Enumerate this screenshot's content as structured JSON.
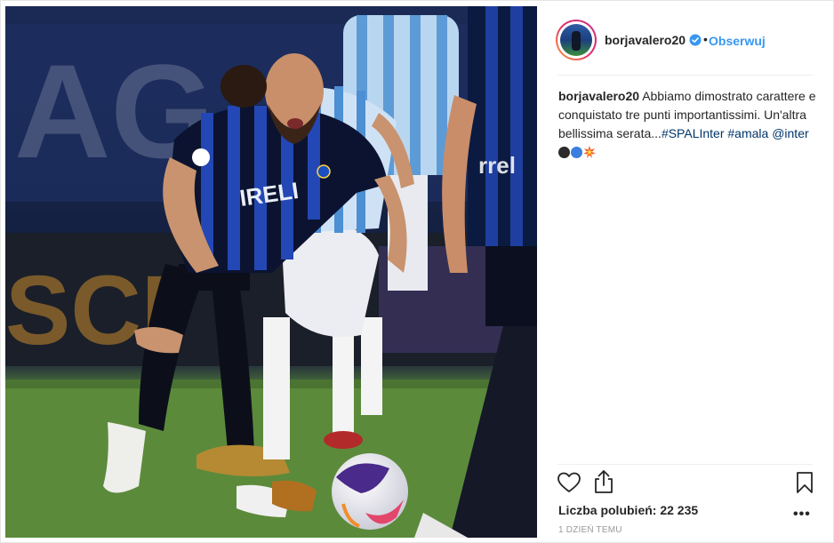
{
  "post": {
    "username": "borjavalero20",
    "separator": "•",
    "follow_label": "Obserwuj",
    "caption": {
      "username": "borjavalero20",
      "text": "Abbiamo dimostrato carattere e conquistato tre punti importantissimi. Un'altra bellissima serata...",
      "hashtags": [
        "#SPALInter",
        "#amala"
      ],
      "mention": "@inter",
      "emoji": [
        "black-circle",
        "blue-circle",
        "collision"
      ]
    },
    "likes_text": "Liczba polubień: 22 235",
    "more_label": "•••",
    "timestamp": "1 DZIEŃ TEMU",
    "photo": {
      "description_icons": [
        "football-player",
        "soccer-ball"
      ]
    },
    "colors": {
      "link_blue": "#3897f0",
      "hashtag": "#003569",
      "text": "#262626",
      "muted": "#999999"
    }
  }
}
